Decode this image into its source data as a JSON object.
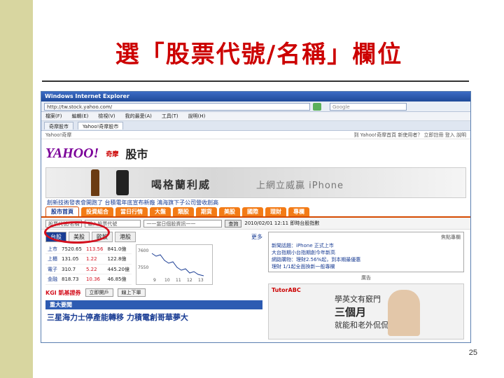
{
  "slide": {
    "title": "選「股票代號/名稱」欄位",
    "page_number": "25",
    "colors": {
      "title": "#cc0000",
      "side_bar": "#d8d6a0",
      "highlight": "#d4101e"
    }
  },
  "browser": {
    "window_title": "Windows Internet Explorer",
    "address": "http://tw.stock.yahoo.com/",
    "search_placeholder": "Google",
    "menu": [
      "檔案(F)",
      "編輯(E)",
      "檢視(V)",
      "我的最愛(A)",
      "工具(T)",
      "說明(H)"
    ],
    "tabs": [
      "奇摩股市",
      "Yahoo!奇摩股市"
    ],
    "top_links_left": "Yahoo!奇摩",
    "top_links_right": "到 Yahoo!奇摩首頁   新使用者？ 立即註冊   登入   說明"
  },
  "site": {
    "logo": "YAHOO!",
    "logo_sub": "奇摩",
    "section": "股市",
    "banner_text1": "喝格蘭利威",
    "banner_text2": "上網立威贏 iPhone",
    "news_ticker": "創新技術發表會開跑了   台積電年底宣布新廠   鴻海旗下子公司營收創高",
    "nav_tabs": [
      "股市首頁",
      "投資組合",
      "當日行情",
      "大盤",
      "類股",
      "期貨",
      "美股",
      "國際",
      "理財",
      "專欄"
    ],
    "query": {
      "field_label": "股票代號/名稱",
      "input_placeholder": "輸入股票代號",
      "select_value": "一一當日個股資訊一一",
      "button": "查詢",
      "timestamp": "2010/02/01 12:11 即時台股指數"
    },
    "market_tabs": [
      "台股",
      "美股",
      "歐股",
      "港股"
    ],
    "more": "更多",
    "indices": [
      {
        "name": "上市",
        "value": "7520.65",
        "change": "113.56",
        "volume": "841.0億"
      },
      {
        "name": "上櫃",
        "value": "131.05",
        "change": "1.22",
        "volume": "122.8億"
      },
      {
        "name": "電子",
        "value": "310.7",
        "change": "5.22",
        "volume": "445.20億"
      },
      {
        "name": "金融",
        "value": "818.73",
        "change": "10.36",
        "volume": "46.85億"
      }
    ],
    "chart_axis": [
      "7600",
      "7550",
      "9",
      "10",
      "11",
      "12",
      "13"
    ],
    "kgi": {
      "logo": "KGI 凱基證券",
      "buttons": [
        "立即開戶",
        "線上下單"
      ]
    },
    "news": {
      "section": "重大要聞",
      "headline": "三星海力士停產能轉移 力積電創哥華夢大"
    },
    "features": {
      "title": "焦點專欄",
      "items": [
        "新聞話題：iPhone 正式上市",
        "大台指期小台指期創今年新高",
        "網路購物：理財2.56%起，到本期最優惠",
        "理財 1/1起全面換新一般專欄"
      ]
    },
    "ad": {
      "label": "廣告",
      "brand": "TutorABC",
      "line1": "學英文有竅門",
      "line2": "三個月",
      "line3": "就能和老外侃侃而談"
    }
  }
}
